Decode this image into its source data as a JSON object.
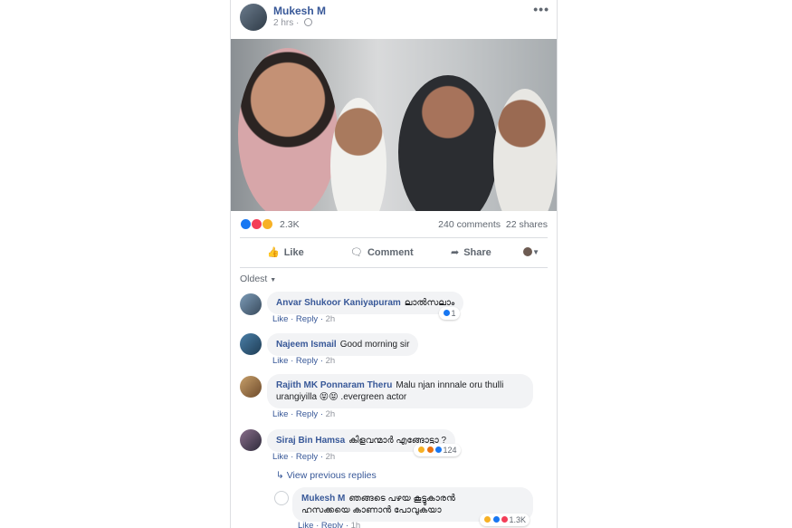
{
  "post": {
    "author": "Mukesh M",
    "time": "2 hrs",
    "more": "•••",
    "reaction_count": "2.3K",
    "comments": "240 comments",
    "shares": "22 shares"
  },
  "actions": {
    "like": "Like",
    "comment": "Comment",
    "share": "Share"
  },
  "sort_label": "Oldest",
  "comments": [
    {
      "name": "Anvar Shukoor Kaniyapuram",
      "text": "ലാൽസലാം",
      "like": "Like",
      "reply": "Reply",
      "time": "2h",
      "reactions": "1"
    },
    {
      "name": "Najeem Ismail",
      "text": "Good morning sir",
      "like": "Like",
      "reply": "Reply",
      "time": "2h"
    },
    {
      "name": "Rajith MK Ponnaram Theru",
      "text_line1": "Malu njan innnale oru thulli",
      "text_line2": "urangiyilla 😝😝 .evergreen actor",
      "like": "Like",
      "reply": "Reply",
      "time": "2h"
    },
    {
      "name": "Siraj Bin Hamsa",
      "text": "കിളവന്മാർ എങ്ങോട്ടാ ?",
      "like": "Like",
      "reply": "Reply",
      "time": "2h",
      "reactions": "124"
    }
  ],
  "view_previous": "View previous replies",
  "reply": {
    "name": "Mukesh M",
    "text_line1": "ഞങ്ങടെ പഴയ കൂട്ടുകാരൻ",
    "text_line2": "ഹസക്കയെ കാണാൻ പോവുകയാ",
    "like": "Like",
    "reply": "Reply",
    "time": "1h",
    "reactions": "1.3K"
  },
  "colors": {
    "link": "#385898",
    "like_blue": "#1877f2",
    "love_red": "#f33e58",
    "wow_yellow": "#f7b125"
  }
}
